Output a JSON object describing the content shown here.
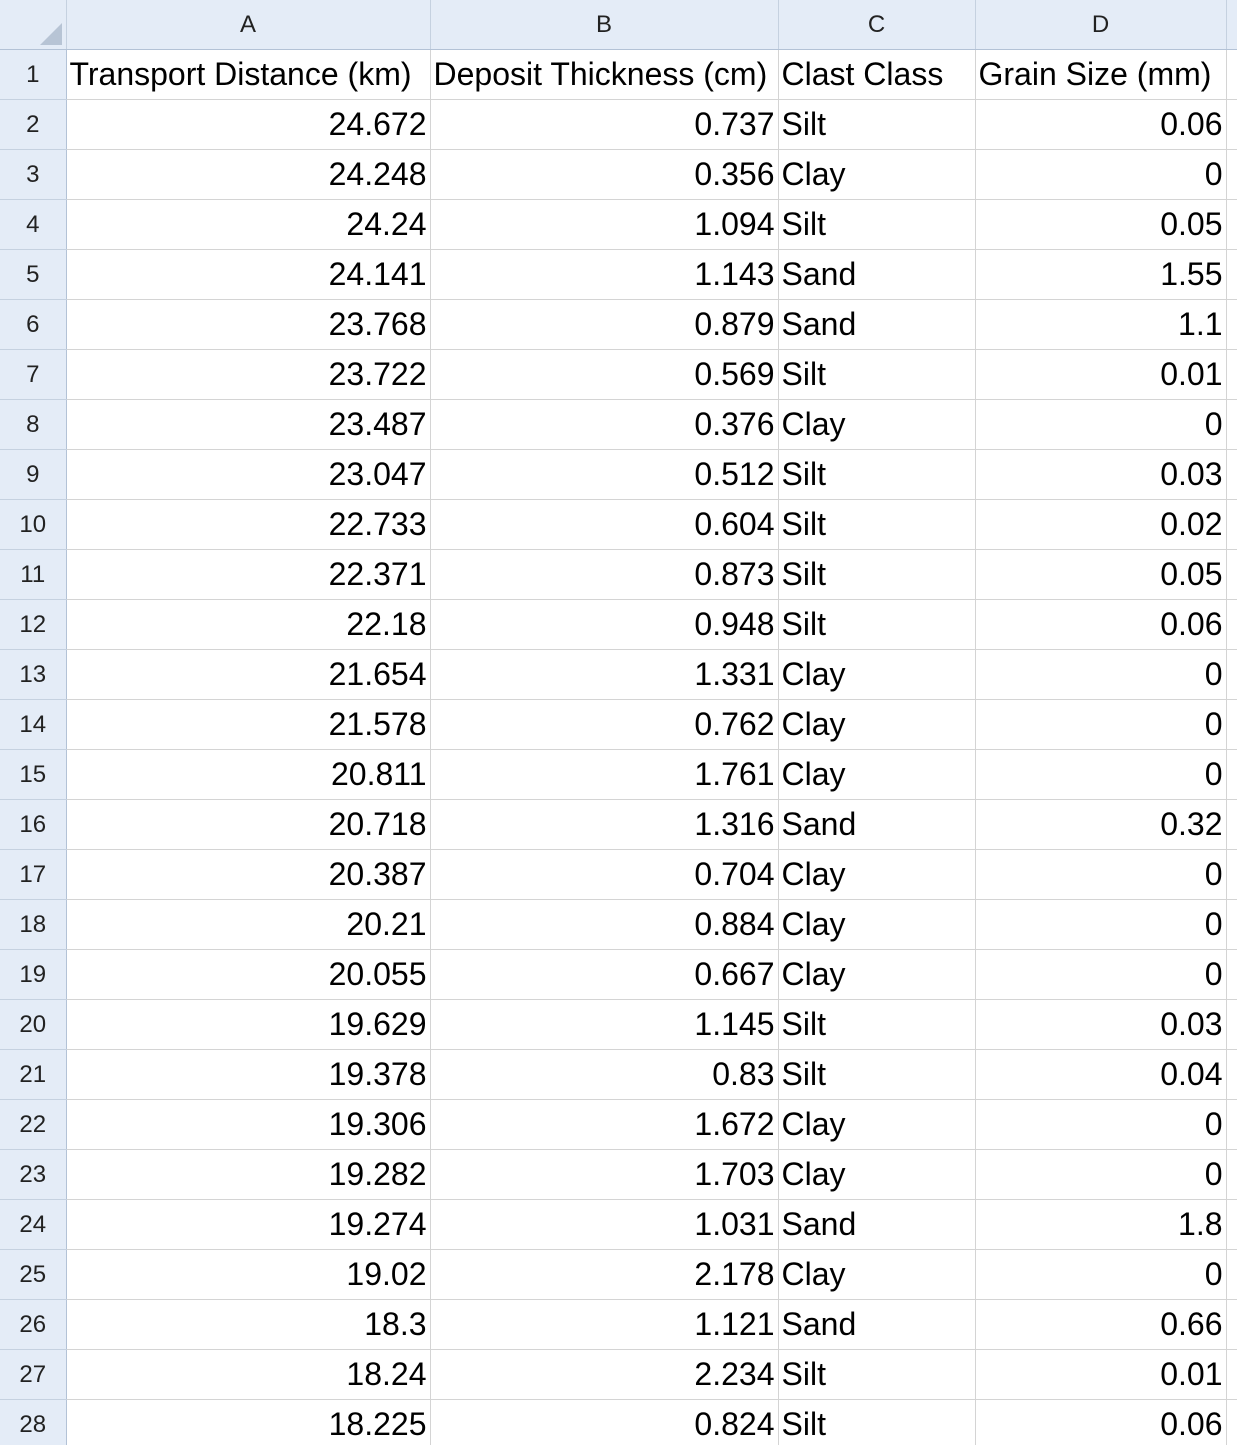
{
  "column_headers": [
    "A",
    "B",
    "C",
    "D"
  ],
  "row_numbers": [
    "1",
    "2",
    "3",
    "4",
    "5",
    "6",
    "7",
    "8",
    "9",
    "10",
    "11",
    "12",
    "13",
    "14",
    "15",
    "16",
    "17",
    "18",
    "19",
    "20",
    "21",
    "22",
    "23",
    "24",
    "25",
    "26",
    "27",
    "28"
  ],
  "header_row": [
    "Transport Distance (km)",
    "Deposit Thickness (cm)",
    "Clast Class",
    "Grain Size (mm)"
  ],
  "rows": [
    [
      "24.672",
      "0.737",
      "Silt",
      "0.06"
    ],
    [
      "24.248",
      "0.356",
      "Clay",
      "0"
    ],
    [
      "24.24",
      "1.094",
      "Silt",
      "0.05"
    ],
    [
      "24.141",
      "1.143",
      "Sand",
      "1.55"
    ],
    [
      "23.768",
      "0.879",
      "Sand",
      "1.1"
    ],
    [
      "23.722",
      "0.569",
      "Silt",
      "0.01"
    ],
    [
      "23.487",
      "0.376",
      "Clay",
      "0"
    ],
    [
      "23.047",
      "0.512",
      "Silt",
      "0.03"
    ],
    [
      "22.733",
      "0.604",
      "Silt",
      "0.02"
    ],
    [
      "22.371",
      "0.873",
      "Silt",
      "0.05"
    ],
    [
      "22.18",
      "0.948",
      "Silt",
      "0.06"
    ],
    [
      "21.654",
      "1.331",
      "Clay",
      "0"
    ],
    [
      "21.578",
      "0.762",
      "Clay",
      "0"
    ],
    [
      "20.811",
      "1.761",
      "Clay",
      "0"
    ],
    [
      "20.718",
      "1.316",
      "Sand",
      "0.32"
    ],
    [
      "20.387",
      "0.704",
      "Clay",
      "0"
    ],
    [
      "20.21",
      "0.884",
      "Clay",
      "0"
    ],
    [
      "20.055",
      "0.667",
      "Clay",
      "0"
    ],
    [
      "19.629",
      "1.145",
      "Silt",
      "0.03"
    ],
    [
      "19.378",
      "0.83",
      "Silt",
      "0.04"
    ],
    [
      "19.306",
      "1.672",
      "Clay",
      "0"
    ],
    [
      "19.282",
      "1.703",
      "Clay",
      "0"
    ],
    [
      "19.274",
      "1.031",
      "Sand",
      "1.8"
    ],
    [
      "19.02",
      "2.178",
      "Clay",
      "0"
    ],
    [
      "18.3",
      "1.121",
      "Sand",
      "0.66"
    ],
    [
      "18.24",
      "2.234",
      "Silt",
      "0.01"
    ],
    [
      "18.225",
      "0.824",
      "Silt",
      "0.06"
    ]
  ]
}
